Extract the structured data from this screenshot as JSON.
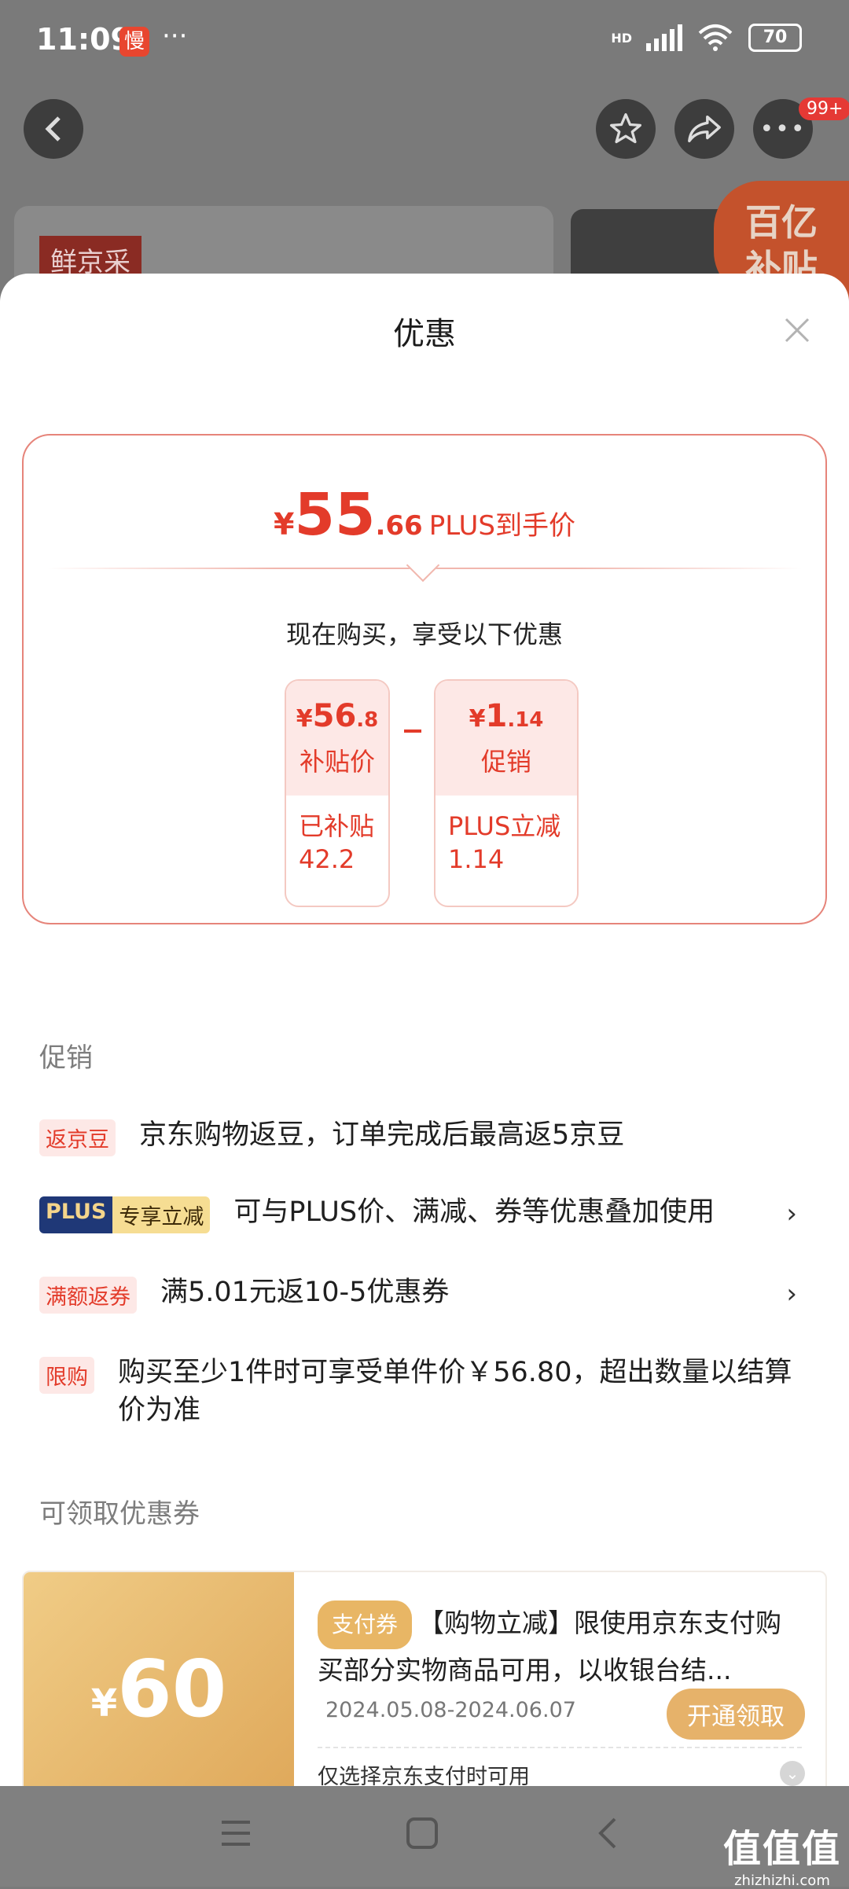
{
  "status_bar": {
    "time": "11:09",
    "app_badge": "慢",
    "more": "···",
    "network": "HD",
    "battery": "70"
  },
  "header": {
    "notification_count": "99+",
    "product_tag": "鲜京采",
    "subsidy_badge_line1": "百亿",
    "subsidy_badge_line2": "补贴"
  },
  "sheet": {
    "title": "优惠",
    "price_card": {
      "currency": "¥",
      "price_int": "55",
      "price_dec": ".66",
      "price_label": "PLUS到手价",
      "buy_now_text": "现在购买，享受以下优惠",
      "subsidy_box": {
        "currency": "¥",
        "amount_int": "56",
        "amount_dec": ".8",
        "name": "补贴价",
        "detail_line1": "已补贴",
        "detail_line2": "42.2"
      },
      "promo_box": {
        "currency": "¥",
        "amount_int": "1",
        "amount_dec": ".14",
        "name": "促销",
        "detail_line1": "PLUS立减",
        "detail_line2": "1.14"
      }
    },
    "promotions": {
      "section_title": "促销",
      "items": [
        {
          "tag": "返京豆",
          "text": "京东购物返豆，订单完成后最高返5京豆"
        },
        {
          "tag_a": "PLUS",
          "tag_b": "专享立减",
          "text": "可与PLUS价、满减、券等优惠叠加使用",
          "chevron": "›"
        },
        {
          "tag": "满额返券",
          "text": "满5.01元返10-5优惠券",
          "chevron": "›"
        },
        {
          "tag": "限购",
          "text": "购买至少1件时可享受单件价￥56.80，超出数量以结算价为准"
        }
      ]
    },
    "coupons": {
      "section_title": "可领取优惠券",
      "coupon": {
        "currency": "¥",
        "amount": "60",
        "type_tag": "支付券",
        "title": "【购物立减】限使用京东支付购买部分实物商品可用，以收银台结...",
        "date_range": "2024.05.08-2024.06.07",
        "claim_label": "开通领取",
        "note": "仅选择京东支付时可用"
      }
    }
  },
  "watermark": {
    "line1": "值值值",
    "line2": "zhizhizhi.com"
  },
  "colors": {
    "accent": "#e33b2a",
    "gold": "#e6b26a",
    "plus_navy": "#1f3877"
  }
}
